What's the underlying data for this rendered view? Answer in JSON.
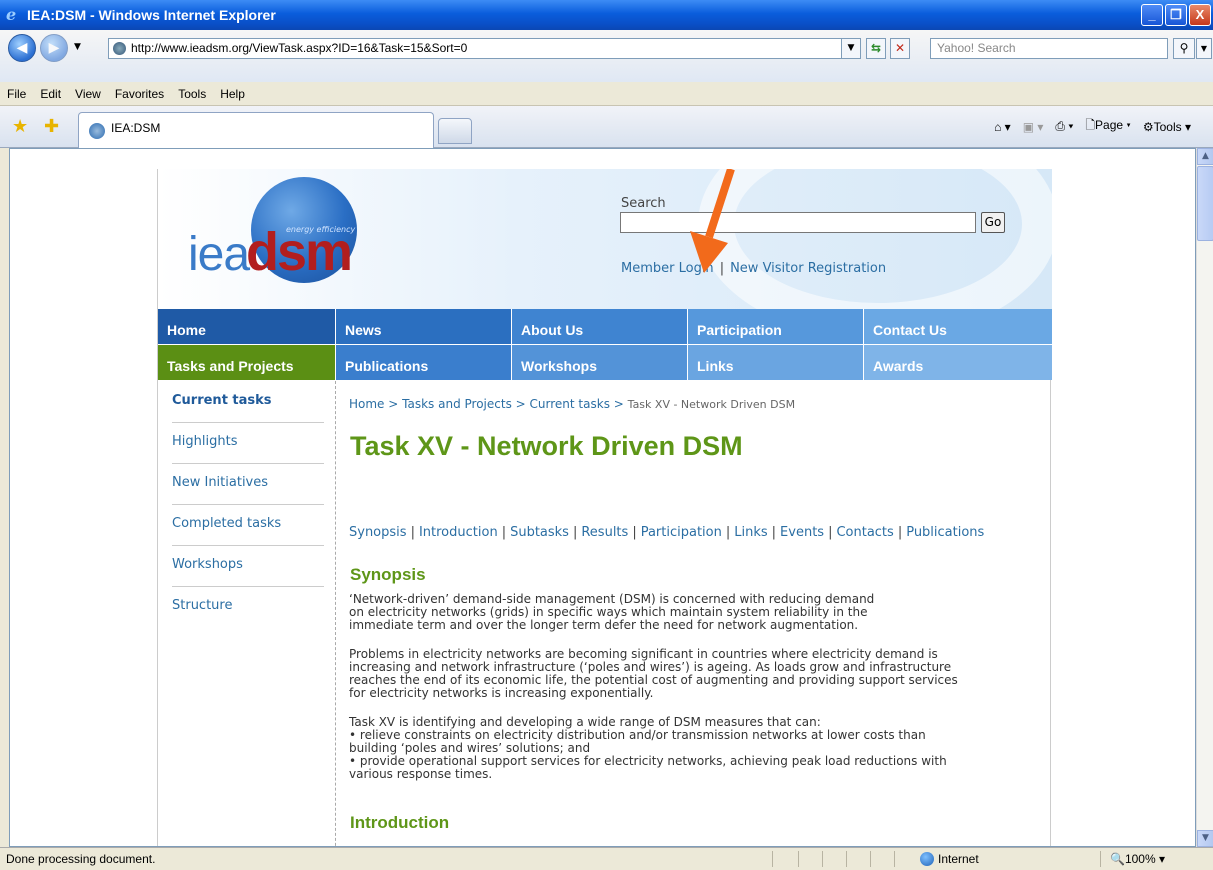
{
  "window": {
    "title": "IEA:DSM - Windows Internet Explorer",
    "controls": [
      "_",
      "❐",
      "X"
    ]
  },
  "address": {
    "url": "http://www.ieadsm.org/ViewTask.aspx?ID=16&Task=15&Sort=0",
    "search_placeholder": "Yahoo! Search"
  },
  "menu": [
    "File",
    "Edit",
    "View",
    "Favorites",
    "Tools",
    "Help"
  ],
  "tab": {
    "label": "IEA:DSM"
  },
  "commandbar": {
    "page": "Page",
    "tools": "Tools"
  },
  "site": {
    "logo_iea": "iea",
    "logo_dsm": "dsm",
    "logo_tagline": "energy efficiency",
    "search_label": "Search",
    "go_label": "Go",
    "member_login": "Member Login",
    "separator": "|",
    "visitor_registration": "New Visitor Registration",
    "arrow_color": "#f26a1b"
  },
  "nav": {
    "row1": [
      "Home",
      "News",
      "About Us",
      "Participation",
      "Contact Us"
    ],
    "row2": [
      "Tasks and Projects",
      "Publications",
      "Workshops",
      "Links",
      "Awards"
    ]
  },
  "sidebar": {
    "items": [
      "Current tasks",
      "Highlights",
      "New Initiatives",
      "Completed tasks",
      "Workshops",
      "Structure"
    ]
  },
  "breadcrumb": {
    "home": "Home",
    "sep": ">",
    "tasks": "Tasks and Projects",
    "current_tasks": "Current tasks",
    "current": "Task XV - Network Driven DSM"
  },
  "main": {
    "title": "Task XV - Network Driven DSM",
    "sublinks": [
      "Synopsis",
      "Introduction",
      "Subtasks",
      "Results",
      "Participation",
      "Links",
      "Events",
      "Contacts",
      "Publications"
    ],
    "synopsis_heading": "Synopsis",
    "synopsis_p1": [
      "‘Network-driven’ demand-side management (DSM) is concerned with reducing demand",
      "on electricity networks (grids) in specific ways which maintain system reliability in the",
      "immediate term and over the longer term defer the need for network augmentation."
    ],
    "synopsis_p2": [
      "Problems in electricity networks are becoming significant in countries where electricity demand is",
      "increasing and network infrastructure (‘poles and wires’) is ageing. As loads grow and infrastructure",
      "reaches the end of its economic life, the potential cost of augmenting and providing support services",
      "for electricity networks is increasing exponentially."
    ],
    "synopsis_p3": [
      "Task XV is identifying and developing a wide range of DSM measures that can:",
      "• relieve constraints on electricity distribution and/or transmission networks at lower costs than",
      "building ‘poles and wires’ solutions; and",
      "• provide operational support services for electricity networks, achieving peak load reductions with",
      "various response times."
    ],
    "intro_heading": "Introduction"
  },
  "status": {
    "text": "Done processing document.",
    "zone": "Internet",
    "zoom": "100%"
  }
}
